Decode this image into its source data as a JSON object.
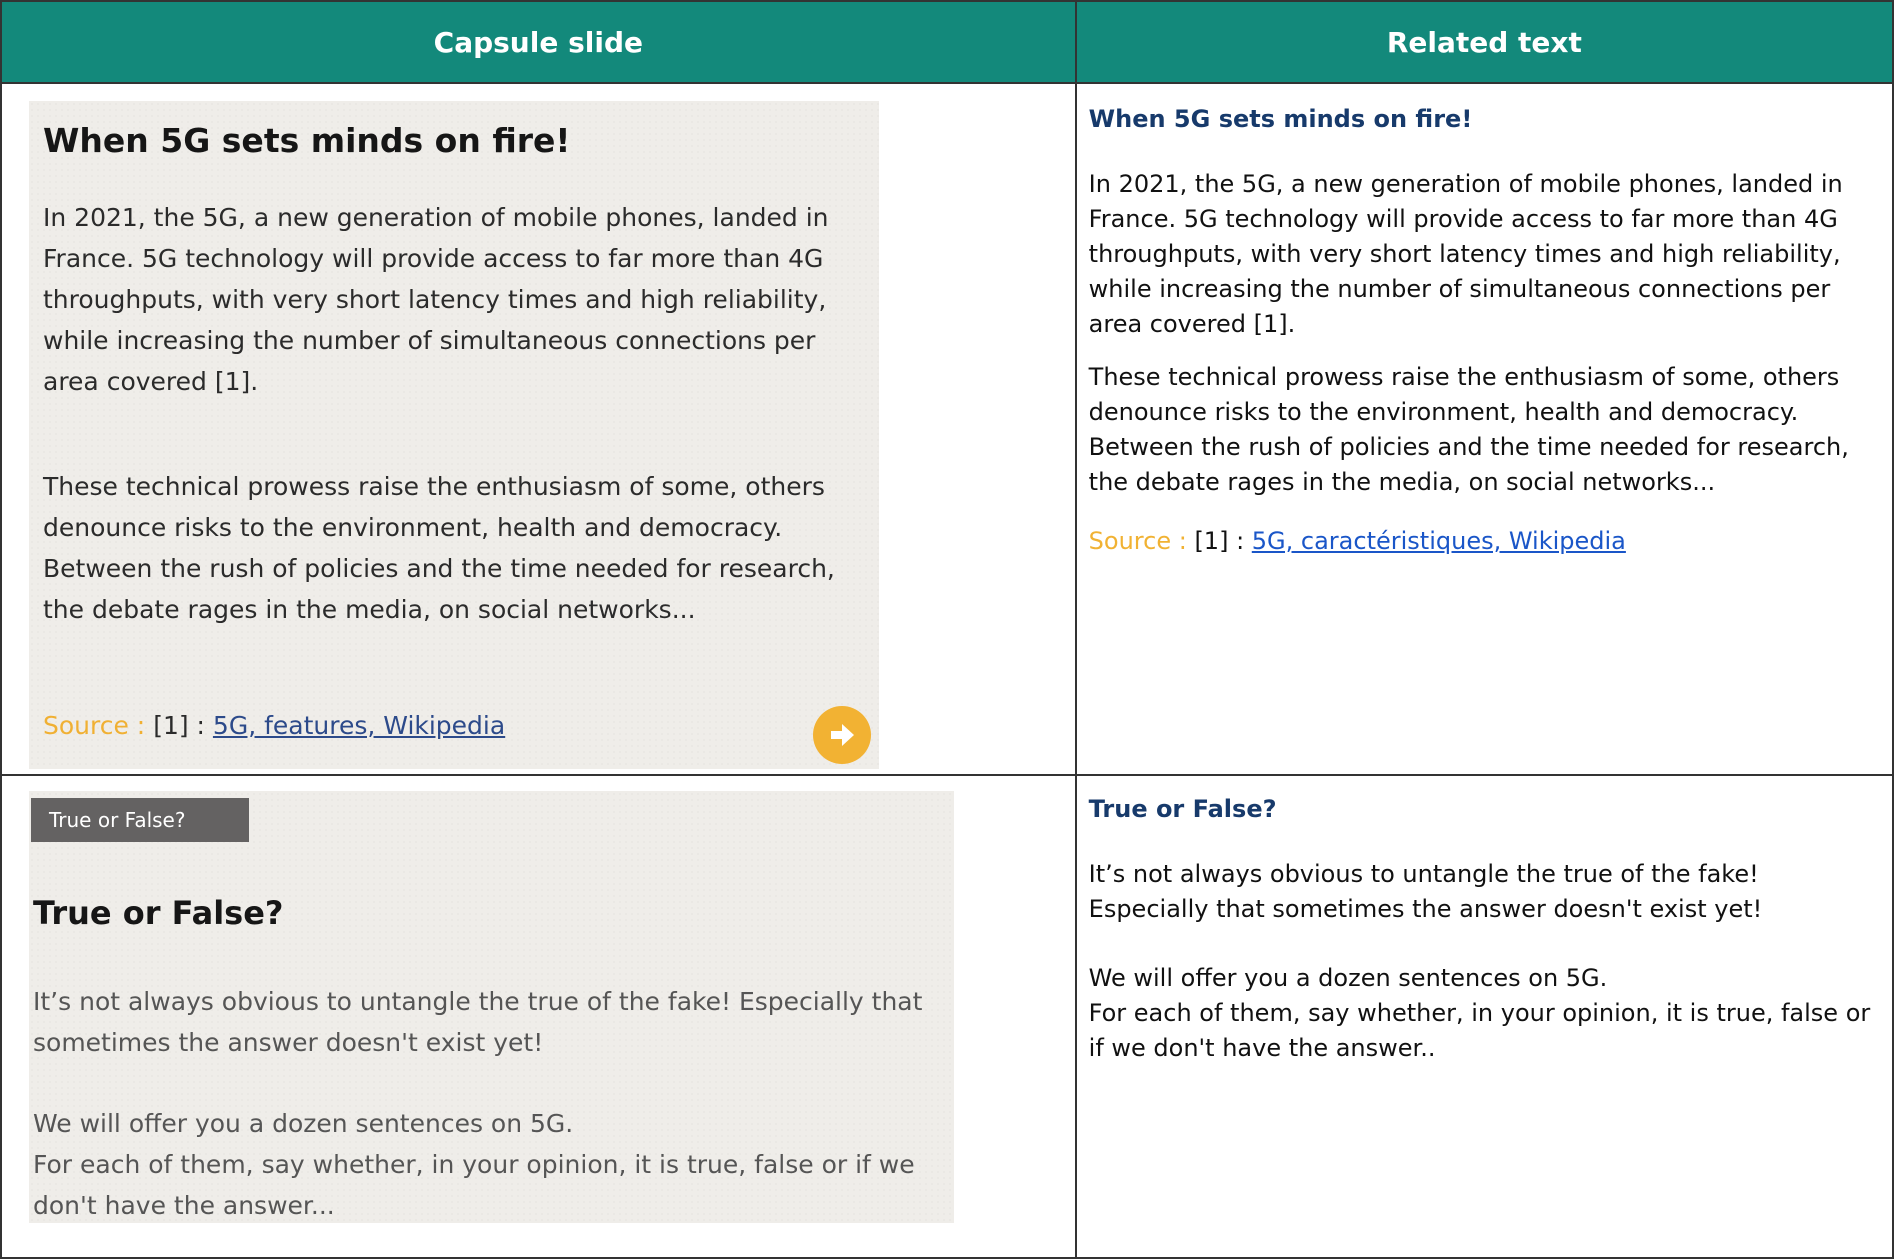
{
  "header": {
    "col1": "Capsule slide",
    "col2": "Related text"
  },
  "row1": {
    "slide": {
      "title": "When 5G sets minds on fire!",
      "paragraph1": "In 2021, the 5G, a new generation of mobile phones, landed in France. 5G technology will provide access to far more than 4G throughputs, with very short latency times and high reliability, while increasing the number of simultaneous connections per area covered [1].",
      "paragraph2": "These technical prowess raise the enthusiasm of some, others denounce risks to the environment, health and democracy. Between the rush of policies and the time needed for research, the debate rages in the media, on social networks...",
      "source_label": "Source : ",
      "source_ref": "[1] : ",
      "source_link": "5G, features, Wikipedia",
      "next_icon": "arrow-right-circle-icon"
    },
    "related": {
      "title": "When 5G sets minds on fire!",
      "paragraph1": "In 2021, the 5G, a new generation of mobile phones, landed in France. 5G technology will provide access to far more than 4G throughputs, with very short latency times and high reliability, while increasing the number of simultaneous connections per area covered [1].",
      "paragraph2": "These technical prowess raise the enthusiasm of some, others denounce risks to the environment, health and democracy. Between the rush of policies and the time needed for research, the debate rages in the media, on social networks...",
      "source_label": "Source : ",
      "source_ref": "[1] : ",
      "source_link": "5G, caractéristiques, Wikipedia"
    }
  },
  "row2": {
    "slide": {
      "badge": "True or False?",
      "title": "True or False?",
      "paragraph1_line1": "It’s not always obvious to untangle the true of the fake! Especially that",
      "paragraph1_line2": "sometimes the answer doesn't exist yet!",
      "paragraph2_line1": "We will offer you a dozen sentences on 5G.",
      "paragraph2_line2": "For each of them, say whether, in your opinion, it is true, false or if we",
      "paragraph2_line3": "don't have the answer..."
    },
    "related": {
      "title": "True or False?",
      "paragraph1_line1": "It’s not always obvious to untangle the true of the fake!",
      "paragraph1_line2": "Especially that sometimes the answer doesn't exist yet!",
      "paragraph2_line1": "We will offer you a dozen sentences on 5G.",
      "paragraph2_line2": "For each of them, say whether, in your opinion, it is true, false or if we don't have the answer.."
    }
  },
  "colors": {
    "header_bg": "#13897b",
    "source_label": "#f1b233",
    "related_title": "#173a6b",
    "link": "#1a56c8"
  }
}
